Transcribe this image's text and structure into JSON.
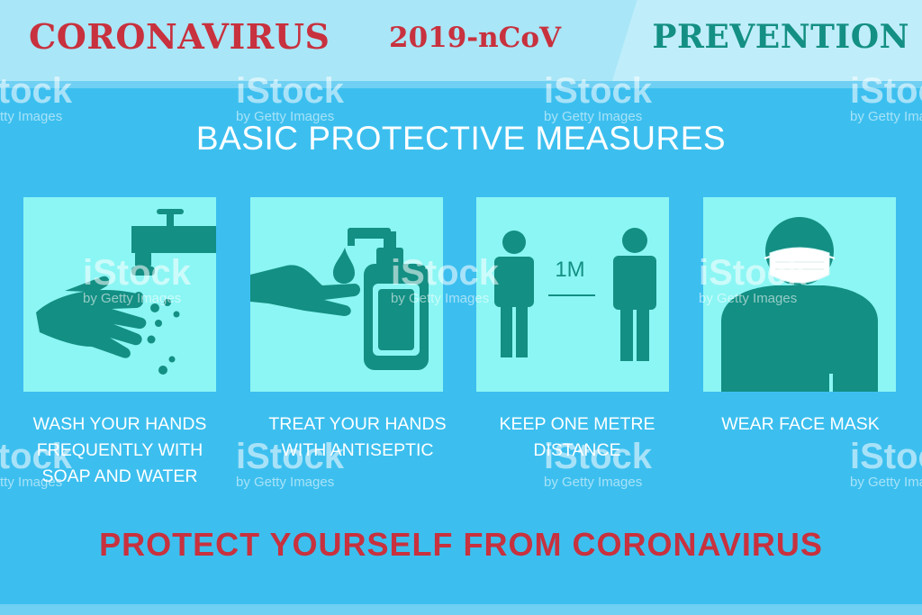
{
  "header": {
    "title": "CORONAVIRUS",
    "code": "2019-nCoV",
    "right_title": "PREVENTION"
  },
  "subtitle": "BASIC PROTECTIVE MEASURES",
  "measures": [
    {
      "icon": "wash-hands-icon",
      "caption_lines": [
        "WASH YOUR HANDS",
        "FREQUENTLY WITH",
        "SOAP AND WATER"
      ]
    },
    {
      "icon": "antiseptic-icon",
      "caption_lines": [
        "TREAT YOUR HANDS",
        "WITH ANTISEPTIC"
      ]
    },
    {
      "icon": "distance-icon",
      "distance_label": "1M",
      "caption_lines": [
        "KEEP ONE METRE",
        "DISTANCE"
      ]
    },
    {
      "icon": "face-mask-icon",
      "caption_lines": [
        "WEAR FACE MASK"
      ]
    }
  ],
  "footer": "PROTECT YOURSELF FROM CORONAVIRUS",
  "watermark": {
    "logo": "iStock",
    "sub": "by Getty Images"
  },
  "colors": {
    "background": "#3cbfef",
    "header": "#a9e6f7",
    "card": "#8cf6f4",
    "icon": "#138f83",
    "title_red": "#c8313e",
    "prevention_green": "#148f83"
  }
}
